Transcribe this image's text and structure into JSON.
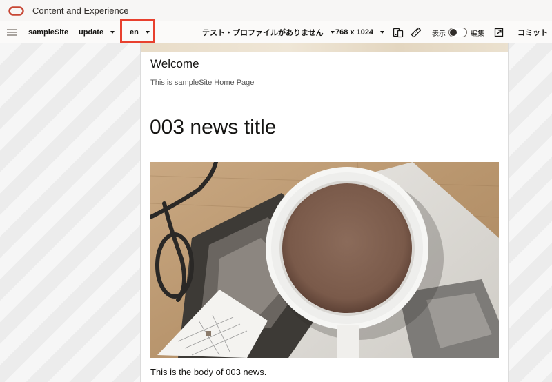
{
  "app": {
    "title": "Content and Experience",
    "logo_icon": "oracle-logo-icon"
  },
  "toolbar": {
    "menu_icon": "hamburger-menu-icon",
    "site_name": "sampleSite",
    "update_label": "update",
    "language": "en",
    "profile_label": "テスト・プロファイルがありません",
    "device_size": "768 x 1024",
    "device_icon": "device-preview-icon",
    "ruler_icon": "ruler-icon",
    "view_label": "表示",
    "edit_label": "編集",
    "edit_toggle_on": false,
    "share_icon": "open-external-icon",
    "commit_label": "コミット",
    "highlight_color": "#e8402e"
  },
  "page": {
    "welcome": "Welcome",
    "subtitle": "This is sampleSite Home Page",
    "news_title": "003 news title",
    "news_image_subject": "coffee-cup-with-glasses-and-notebook",
    "news_body": "This is the body of 003 news."
  }
}
